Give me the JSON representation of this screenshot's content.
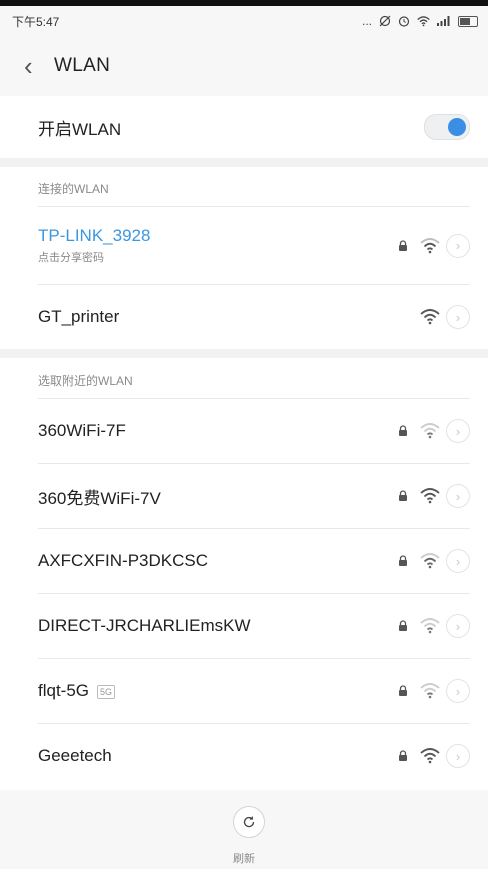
{
  "status_bar": {
    "time": "下午5:47",
    "icons": [
      "more-dots-icon",
      "mute-icon",
      "alarm-icon",
      "wifi-icon",
      "signal-icon",
      "battery-icon"
    ],
    "more": "..."
  },
  "header": {
    "back_icon": "chevron-left-icon",
    "title": "WLAN"
  },
  "wlan_toggle": {
    "label": "开启WLAN",
    "on": true,
    "accent": "#3a8fe4"
  },
  "connected_section": {
    "title": "连接的WLAN",
    "networks": [
      {
        "name": "TP-LINK_3928",
        "subtitle": "点击分享密码",
        "locked": true,
        "active": true
      },
      {
        "name": "GT_printer",
        "subtitle": "",
        "locked": false,
        "active": false
      }
    ]
  },
  "nearby_section": {
    "title": "选取附近的WLAN",
    "networks": [
      {
        "name": "360WiFi-7F",
        "locked": true,
        "signal": "weak"
      },
      {
        "name": "360免费WiFi-7V",
        "locked": true,
        "signal": "strong"
      },
      {
        "name": "AXFCXFIN-P3DKCSC",
        "locked": true,
        "signal": "medium"
      },
      {
        "name": "DIRECT-JRCHARLIEmsKW",
        "locked": true,
        "signal": "weak"
      },
      {
        "name": "flqt-5G",
        "badge": "5G",
        "locked": true,
        "signal": "weak"
      },
      {
        "name": "Geeetech",
        "locked": true,
        "signal": "strong"
      }
    ]
  },
  "bottom": {
    "refresh_label": "刷新",
    "refresh_icon": "refresh-icon"
  },
  "colors": {
    "accent": "#3a8fe4",
    "connected_text": "#3a97e0"
  }
}
